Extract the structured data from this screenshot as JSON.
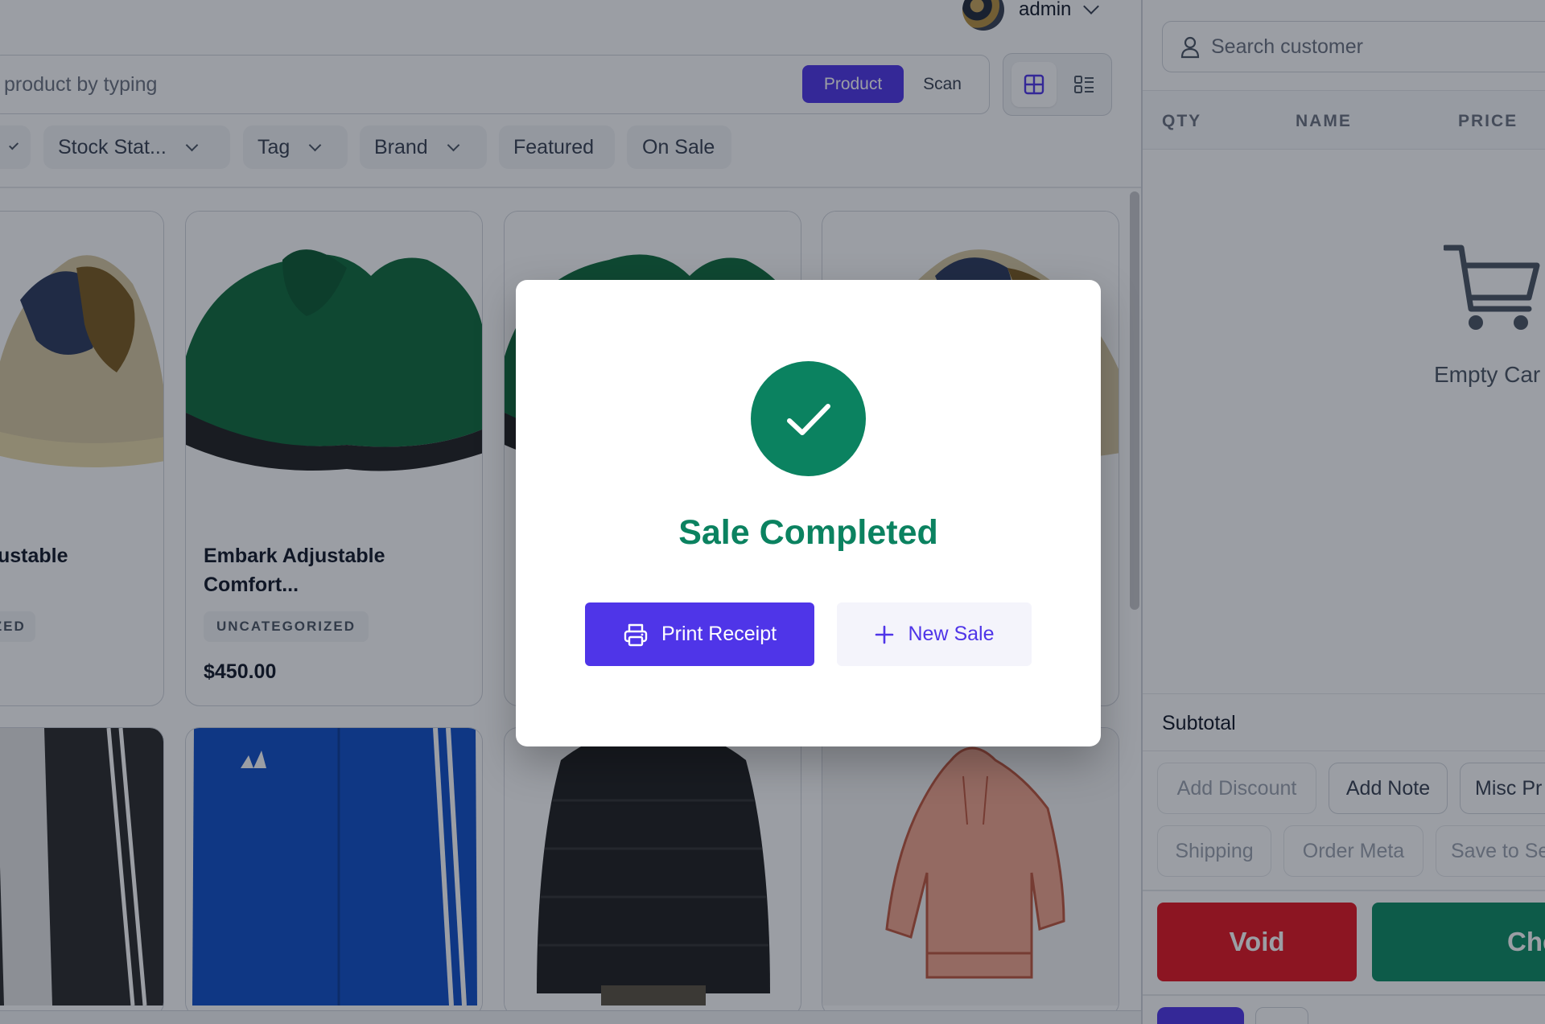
{
  "header": {
    "user_name": "admin"
  },
  "product_search": {
    "placeholder_visible": "product by typing",
    "mode_product": "Product",
    "mode_scan": "Scan"
  },
  "filters": {
    "stock_status": "Stock Stat...",
    "tag": "Tag",
    "brand": "Brand",
    "featured": "Featured",
    "on_sale": "On Sale"
  },
  "products": [
    {
      "title": "ustable",
      "badge": "IZED",
      "price": ""
    },
    {
      "title": "Embark Adjustable Comfort...",
      "badge": "UNCATEGORIZED",
      "price": "$450.00"
    },
    {
      "title": "",
      "badge": "",
      "price": ""
    },
    {
      "title": "",
      "badge": "",
      "price": ""
    }
  ],
  "cart": {
    "search_placeholder": "Search customer",
    "columns": [
      "QTY",
      "NAME",
      "PRICE"
    ],
    "empty_text": "Empty Car",
    "subtotal_label": "Subtotal",
    "actions_row1": [
      "Add Discount",
      "Add Note",
      "Misc Pr"
    ],
    "actions_row2": [
      "Shipping",
      "Order Meta",
      "Save to Se"
    ],
    "void_label": "Void",
    "checkout_label": "Che"
  },
  "modal": {
    "title": "Sale Completed",
    "print_label": "Print Receipt",
    "new_sale_label": "New Sale"
  },
  "colors": {
    "primary": "#4f35e8",
    "success": "#0b8260",
    "danger": "#e5141f"
  }
}
